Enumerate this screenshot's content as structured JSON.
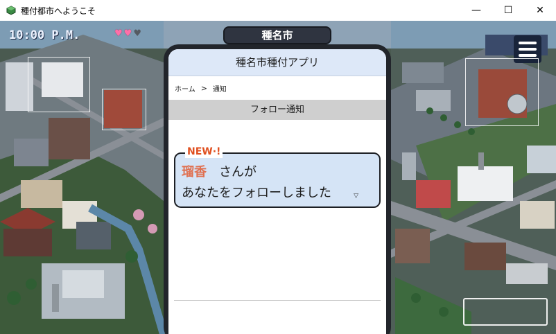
{
  "window": {
    "title": "種付都市へようこそ",
    "minimize": "—",
    "maximize": "☐",
    "close": "✕"
  },
  "hud": {
    "time": "10:00 P.M.",
    "hearts": {
      "full": 2,
      "total": 3,
      "full_color": "#ff6fa8",
      "empty_color": "#555a62"
    },
    "city_name": "種名市",
    "menu_icon": "hamburger-icon"
  },
  "phone": {
    "app_title": "種名市種付アプリ",
    "breadcrumb": {
      "home": "ホーム",
      "separator": ">",
      "current": "通知"
    },
    "section_title": "フォロー通知",
    "notification": {
      "badge": "NEW·!",
      "user_name": "瑠香",
      "line1_suffix": "さんが",
      "line2": "あなたをフォローしました",
      "more_indicator": "▽",
      "name_color": "#e07050",
      "badge_color": "#e05020",
      "bubble_color": "#d5e4f6"
    }
  }
}
